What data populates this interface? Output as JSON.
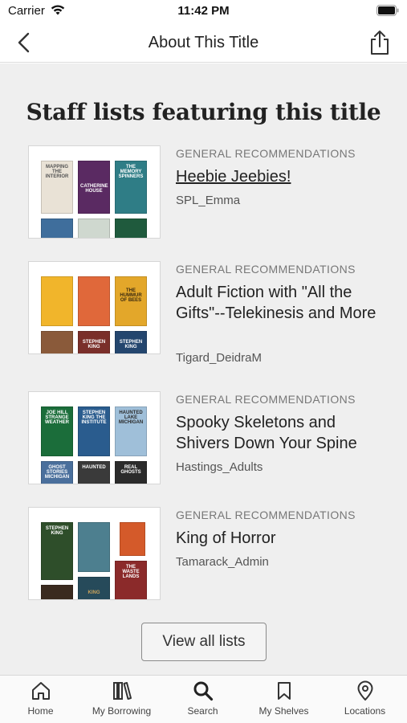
{
  "status_bar": {
    "carrier": "Carrier",
    "time": "11:42 PM"
  },
  "nav": {
    "title": "About This Title"
  },
  "section": {
    "heading": "Staff lists featuring this title"
  },
  "lists": [
    {
      "category": "GENERAL RECOMMENDATIONS",
      "title": "Heebie Jeebies!",
      "author": "SPL_Emma",
      "covers": [
        {
          "color": "#e9e2d6",
          "label": "MAPPING THE INTERIOR"
        },
        {
          "color": "#5a2a62",
          "label": "CATHERINE HOUSE"
        },
        {
          "color": "#2f7d86",
          "label": "THE MEMORY SPINNERS"
        },
        {
          "color": "#3f6e9c",
          "label": ""
        },
        {
          "color": "#cfd8cf",
          "label": ""
        },
        {
          "color": "#1f5a3d",
          "label": ""
        }
      ]
    },
    {
      "category": "GENERAL RECOMMENDATIONS",
      "title": "Adult Fiction with \"All the Gifts\"--Telekinesis and More",
      "author": "Tigard_DeidraM",
      "covers": [
        {
          "color": "#f1b52b",
          "label": ""
        },
        {
          "color": "#e0683a",
          "label": ""
        },
        {
          "color": "#e3a72a",
          "label": "THE HUMMUR OF BEES"
        },
        {
          "color": "#8a5a3a",
          "label": ""
        },
        {
          "color": "#7a2f2a",
          "label": "STEPHEN KING"
        },
        {
          "color": "#24466e",
          "label": "STEPHEN KING"
        }
      ]
    },
    {
      "category": "GENERAL RECOMMENDATIONS",
      "title": "Spooky Skeletons and Shivers Down Your Spine",
      "author": "Hastings_Adults",
      "covers": [
        {
          "color": "#1b6d3a",
          "label": "JOE HILL STRANGE WEATHER"
        },
        {
          "color": "#2a5c8e",
          "label": "STEPHEN KING THE INSTITUTE"
        },
        {
          "color": "#9fbfd9",
          "label": "HAUNTED LAKE MICHIGAN"
        },
        {
          "color": "#4a6f9c",
          "label": "GHOST STORIES MICHIGAN"
        },
        {
          "color": "#3a3a3a",
          "label": "HAUNTED"
        },
        {
          "color": "#2b2b2b",
          "label": "REAL GHOSTS"
        }
      ]
    },
    {
      "category": "GENERAL RECOMMENDATIONS",
      "title": "King of Horror",
      "author": "Tamarack_Admin",
      "covers": [
        {
          "color": "#2e4e2a",
          "label": "STEPHEN KING"
        },
        {
          "color": "#4d7f8f",
          "label": ""
        },
        {
          "color": "#d45a2a",
          "label": ""
        },
        {
          "color": "#3a2a1f",
          "label": ""
        },
        {
          "color": "#264a5a",
          "label": "KING"
        },
        {
          "color": "#8b2a2a",
          "label": "THE WASTE LANDS"
        }
      ]
    }
  ],
  "view_all": {
    "label": "View all lists"
  },
  "tabs": [
    {
      "label": "Home",
      "icon": "home-icon"
    },
    {
      "label": "My Borrowing",
      "icon": "books-icon"
    },
    {
      "label": "Search",
      "icon": "search-icon"
    },
    {
      "label": "My Shelves",
      "icon": "bookmark-icon"
    },
    {
      "label": "Locations",
      "icon": "location-pin-icon"
    }
  ]
}
